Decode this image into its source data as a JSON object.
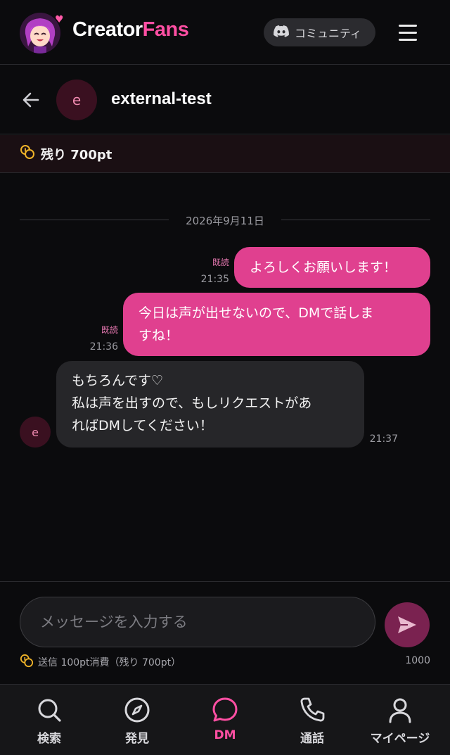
{
  "header": {
    "brand_part1": "Creator",
    "brand_part2": "Fans",
    "community_label": "コミュニティ"
  },
  "chat": {
    "peer_initial": "e",
    "peer_name": "external-test",
    "points_remaining": "残り 700pt",
    "date_separator": "2026年9月11日",
    "messages": [
      {
        "direction": "out",
        "lines": [
          "よろしくお願いします！"
        ],
        "read": "既読",
        "time": "21:35"
      },
      {
        "direction": "out",
        "lines": [
          "今日は声が出せないので、DMで話しま",
          "すね！"
        ],
        "read": "既読",
        "time": "21:36"
      },
      {
        "direction": "in",
        "lines": [
          "もちろんです♡",
          "私は声を出すので、もしリクエストがあ",
          "ればDMしてください！"
        ],
        "time": "21:37"
      }
    ]
  },
  "composer": {
    "placeholder": "メッセージを入力する",
    "cost_note": "送信 100pt消費（残り 700pt）",
    "char_limit": "1000"
  },
  "nav": {
    "items": [
      {
        "label": "検索",
        "icon": "search-icon"
      },
      {
        "label": "発見",
        "icon": "compass-icon"
      },
      {
        "label": "DM",
        "icon": "chat-bubble-icon",
        "active": true
      },
      {
        "label": "通話",
        "icon": "phone-icon"
      },
      {
        "label": "マイページ",
        "icon": "user-icon"
      }
    ]
  },
  "colors": {
    "accent": "#ff4fa3",
    "bubble_out": "#e0408f",
    "bubble_in": "#262629",
    "background": "#0b0b0d"
  }
}
